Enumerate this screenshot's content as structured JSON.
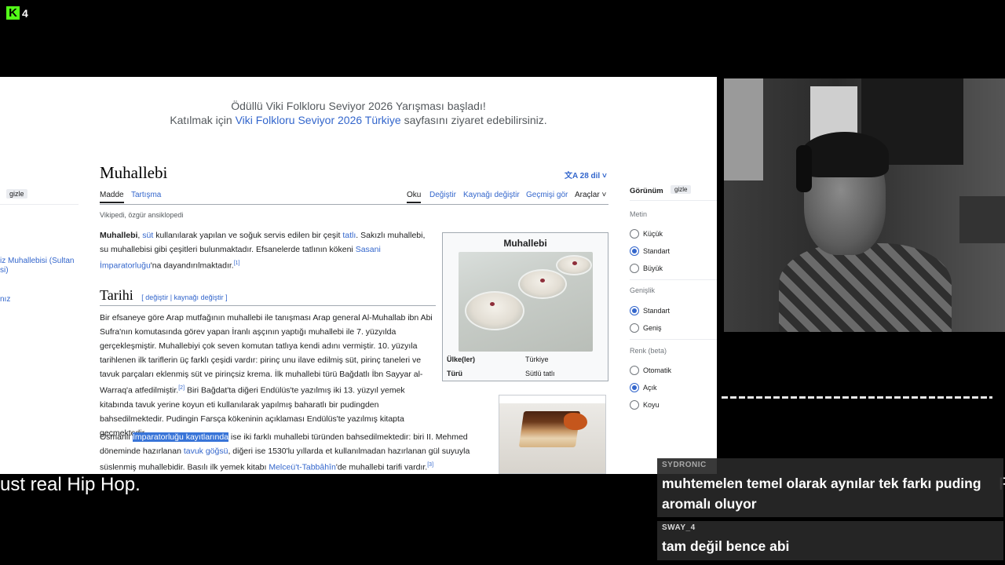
{
  "overlay": {
    "logo_letter": "K",
    "viewer_count": "4",
    "brand_color": "#53fc18"
  },
  "banner": {
    "line1": "Ödüllü Viki Folkloru Seviyor 2026 Yarışması başladı!",
    "line2_pre": "Katılmak için ",
    "line2_link": "Viki Folkloru Seviyor 2026 Türkiye",
    "line2_post": " sayfasını ziyaret edebilirsiniz."
  },
  "left_sidebar": {
    "gizle": "gizle",
    "link1": "iz Muhallebisi (Sultan si)",
    "link2": "nız"
  },
  "article": {
    "title": "Muhallebi",
    "lang_button": "28 dil",
    "tabs": {
      "madde": "Madde",
      "tartisma": "Tartışma",
      "oku": "Oku",
      "degistir": "Değiştir",
      "kaynagi": "Kaynağı değiştir",
      "gecmis": "Geçmişi gör",
      "araclar": "Araçlar"
    },
    "tagline": "Vikipedi, özgür ansiklopedi",
    "intro": {
      "b": "Muhallebi",
      "t1": ", ",
      "l1": "süt",
      "t2": " kullanılarak yapılan ve soğuk servis edilen bir çeşit ",
      "l2": "tatlı",
      "t3": ". Sakızlı muhallebi, su muhallebisi gibi çeşitleri bulunmaktadır. Efsanelerde tatlının kökeni ",
      "l3": "Sasani İmparatorluğu",
      "t4": "'na dayandırılmaktadır.",
      "ref": "[1]"
    },
    "section": {
      "title": "Tarihi",
      "edit": "[ değiştir | kaynağı değiştir ]"
    },
    "para2": {
      "t1": "Bir efsaneye göre Arap mutfağının muhallebi ile tanışması Arap general Al-Muhallab ibn Abi Sufra'nın komutasında görev yapan İranlı aşçının yaptığı muhallebi ile 7. yüzyılda gerçekleşmiştir. Muhallebiyi çok seven komutan tatlıya kendi adını vermiştir. 10. yüzyıla tarihlenen ilk tariflerin üç farklı çeşidi vardır: pirinç unu ilave edilmiş süt, pirinç taneleri ve tavuk parçaları eklenmiş süt ve pirinçsiz krema. İlk muhallebi türü Bağdatlı İbn Sayyar al-Warraq'a atfedilmiştir.",
      "ref": "[2]",
      "t2": " Biri Bağdat'ta diğeri Endülüs'te yazılmış iki 13. yüzyıl yemek kitabında tavuk yerine koyun eti kullanılarak yapılmış baharatlı bir pudingden bahsedilmektedir. Pudingin Farsça kökeninin açıklaması Endülüs'te yazılmış kitapta geçmektedir."
    },
    "para3": {
      "t1": "Osmanlı ",
      "sel": "İmparatorluğu kayıtlarında",
      "t2": " ise iki farklı muhallebi türünden bahsedilmektedir: biri II. Mehmed döneminde hazırlanan ",
      "l1": "tavuk göğsü",
      "t3": ", diğeri ise 1530'lu yıllarda et kullanılmadan hazırlanan gül suyuyla süslenmiş muhallebidir. Basılı ilk yemek kitabı ",
      "l2": "Melceü't-Tabbâhîn",
      "t4": "'de muhallebi tarifi vardır.",
      "ref": "[3]"
    },
    "infobox": {
      "title": "Muhallebi",
      "row1_key": "Ülke(ler)",
      "row1_val": "Türkiye",
      "row2_key": "Türü",
      "row2_val": "Sütlü tatlı"
    }
  },
  "appearance": {
    "title": "Görünüm",
    "gizle": "gizle",
    "metin": "Metin",
    "kucuk": "Küçük",
    "standart": "Standart",
    "buyuk": "Büyük",
    "genislik": "Genişlik",
    "gen_standart": "Standart",
    "genis": "Geniş",
    "renk": "Renk (beta)",
    "otomatik": "Otomatik",
    "acik": "Açık",
    "koyu": "Koyu"
  },
  "caption": {
    "text": "ust real Hip Hop.",
    "right_edge": "R"
  },
  "chat": [
    {
      "user": "SYDRONIC",
      "text": "muhtemelen temel olarak aynılar tek farkı puding aromalı oluyor"
    },
    {
      "user": "SWAY_4",
      "text": "tam değil bence abi"
    }
  ]
}
